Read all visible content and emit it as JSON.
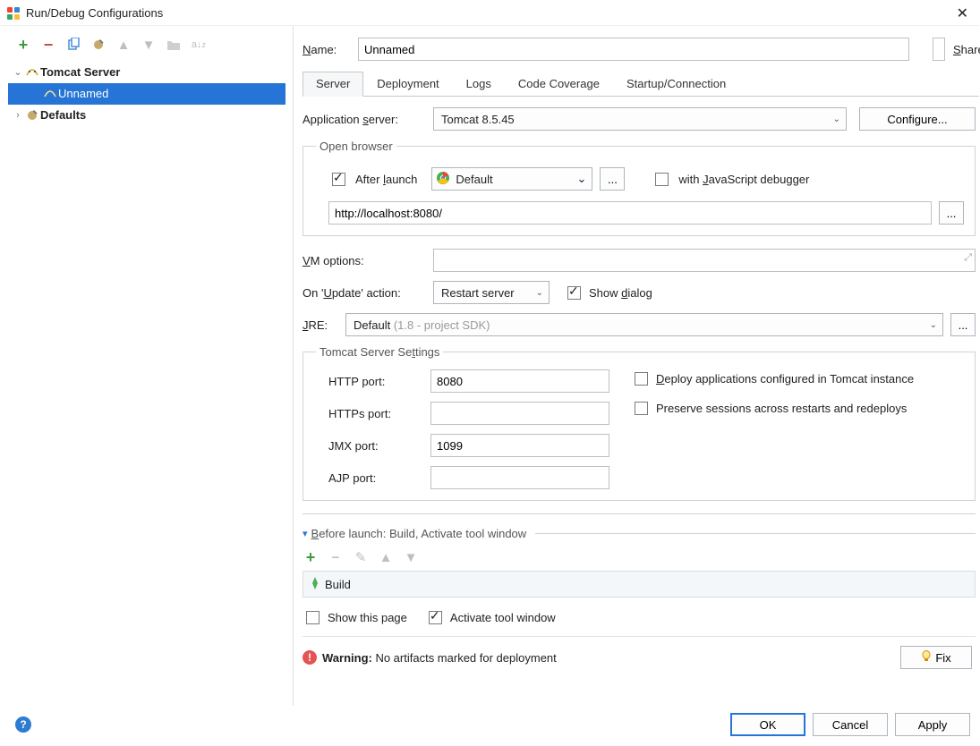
{
  "window": {
    "title": "Run/Debug Configurations",
    "close": "✕"
  },
  "toolbar": {
    "add": "+",
    "remove": "−",
    "copy": "⧉",
    "wrench": "🔧",
    "up": "↑",
    "down": "↓",
    "folder": "📁",
    "sort": "a↓z"
  },
  "tree": {
    "tomcat_server": "Tomcat Server",
    "unnamed": "Unnamed",
    "defaults": "Defaults"
  },
  "name_label": "Name:",
  "name_value": "Unnamed",
  "share_label": "Share",
  "tabs": [
    "Server",
    "Deployment",
    "Logs",
    "Code Coverage",
    "Startup/Connection"
  ],
  "app_server": {
    "label": "Application server:",
    "value": "Tomcat 8.5.45",
    "configure": "Configure..."
  },
  "open_browser": {
    "legend": "Open browser",
    "after_launch": "After launch",
    "browser_value": "Default",
    "ellipsis": "...",
    "js_debug": "with JavaScript debugger",
    "url": "http://localhost:8080/"
  },
  "vm_label": "VM options:",
  "update": {
    "label": "On 'Update' action:",
    "value": "Restart server",
    "show_dialog": "Show dialog"
  },
  "jre": {
    "label": "JRE:",
    "value": "Default",
    "hint": "(1.8 - project SDK)"
  },
  "tomcat_settings": {
    "legend": "Tomcat Server Settings",
    "http_port_label": "HTTP port:",
    "http_port": "8080",
    "https_port_label": "HTTPs port:",
    "https_port": "",
    "jmx_port_label": "JMX port:",
    "jmx_port": "1099",
    "ajp_port_label": "AJP port:",
    "ajp_port": "",
    "deploy_check": "Deploy applications configured in Tomcat instance",
    "preserve_check": "Preserve sessions across restarts and redeploys"
  },
  "before_launch": {
    "header": "Before launch: Build, Activate tool window",
    "task": "Build",
    "show_page": "Show this page",
    "activate": "Activate tool window"
  },
  "warning": {
    "bold": "Warning:",
    "text": " No artifacts marked for deployment",
    "fix": "Fix"
  },
  "footer": {
    "ok": "OK",
    "cancel": "Cancel",
    "apply": "Apply"
  }
}
